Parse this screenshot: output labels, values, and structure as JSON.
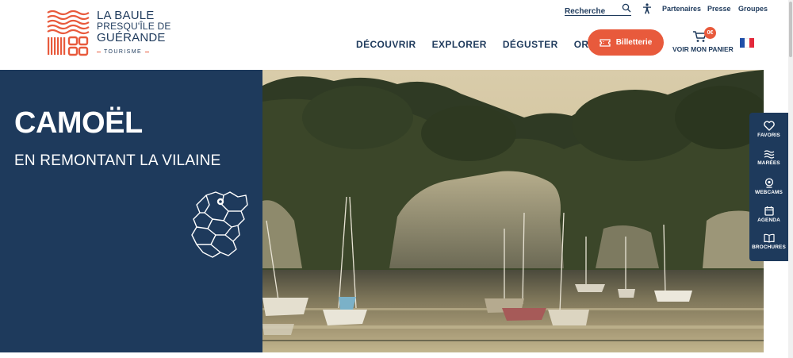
{
  "header": {
    "logo": {
      "line1": "LA BAULE",
      "line2": "PRESQU'ÎLE DE",
      "line3": "GUÉRANDE",
      "sub": "TOURISME",
      "mark_icon": "waves-and-marsh-grid-logo-icon",
      "brand_color": "#e85a3c"
    },
    "search": {
      "placeholder": "Recherche",
      "icon": "search-icon"
    },
    "accessibility_icon": "accessibility-person-icon",
    "utility_links": [
      "Partenaires",
      "Presse",
      "Groupes"
    ],
    "nav": [
      "DÉCOUVRIR",
      "EXPLORER",
      "DÉGUSTER",
      "ORGANISER"
    ],
    "ticket_button": {
      "label": "Billetterie",
      "icon": "ticket-icon",
      "color": "#e85a3c"
    },
    "cart": {
      "label": "VOIR MON PANIER",
      "badge": "0€",
      "icon": "cart-icon"
    },
    "language_flag": "french-flag-icon"
  },
  "hero": {
    "title": "CAMOËL",
    "subtitle": "EN REMONTANT LA VILAINE",
    "panel_color": "#1e3a5c",
    "map_icon": "territory-map-icon",
    "photo": "sailboats-moored-on-river-beneath-wooded-cliffs"
  },
  "side_toolbar": {
    "items": [
      {
        "label": "FAVORIS",
        "icon": "heart-icon"
      },
      {
        "label": "MARÉES",
        "icon": "waves-icon"
      },
      {
        "label": "WEBCAMS",
        "icon": "webcam-icon"
      },
      {
        "label": "AGENDA",
        "icon": "calendar-icon"
      },
      {
        "label": "BROCHURES",
        "icon": "book-icon"
      }
    ]
  }
}
